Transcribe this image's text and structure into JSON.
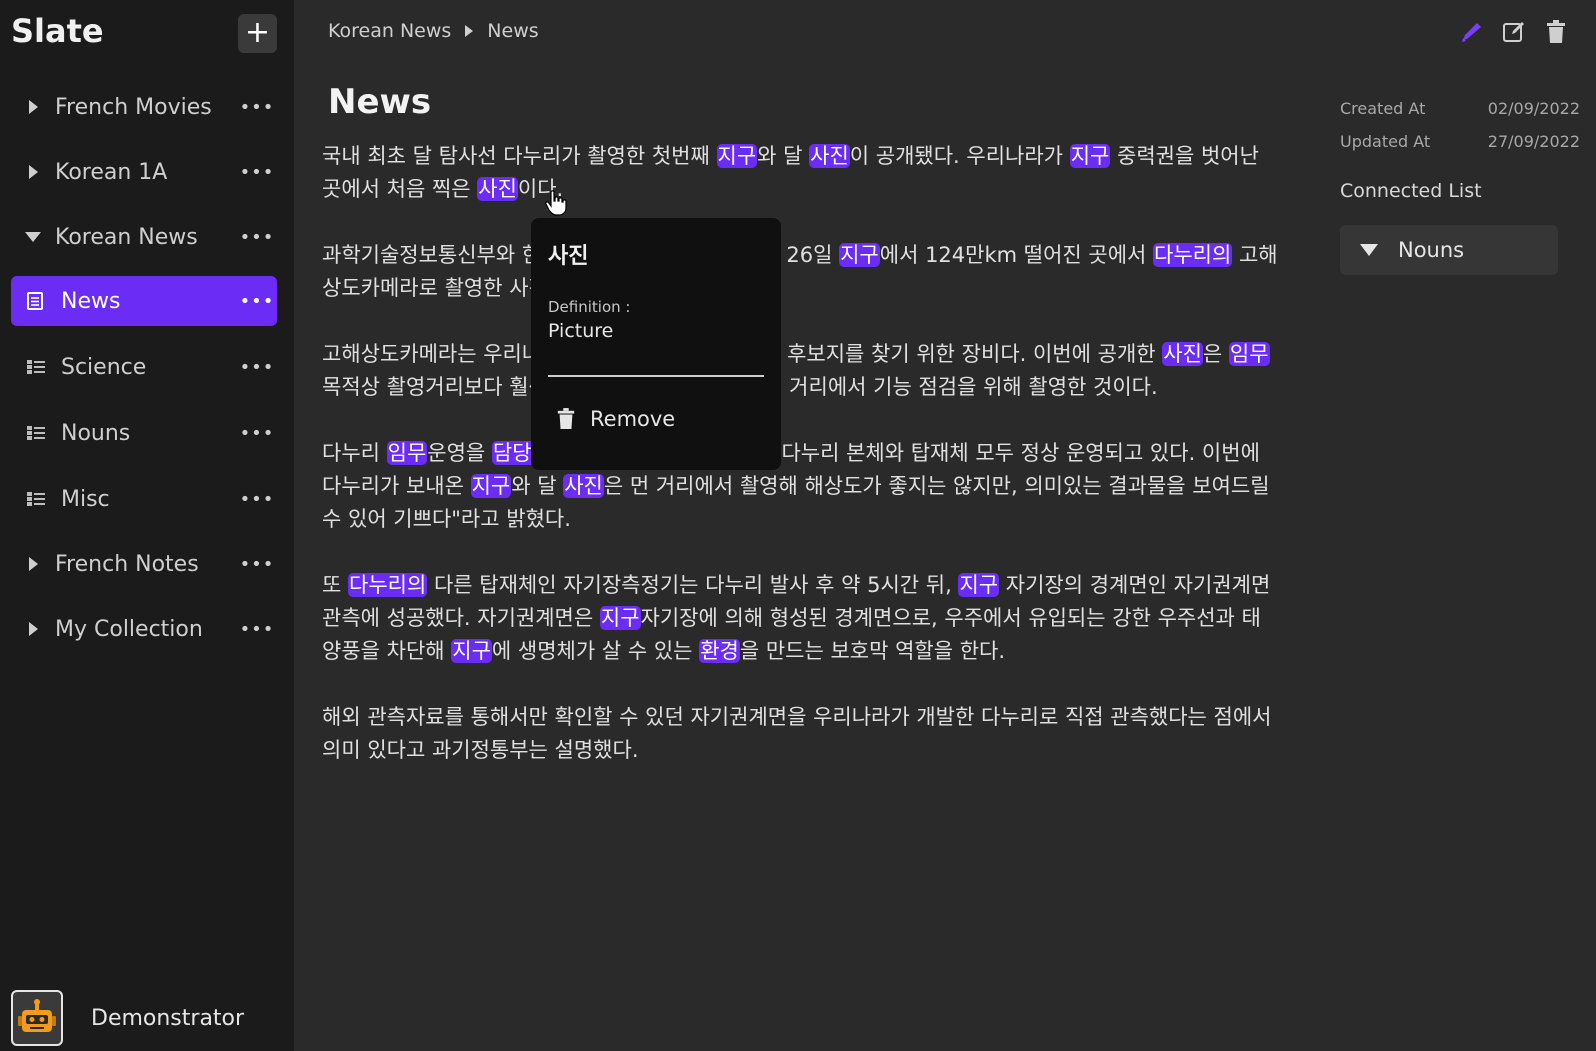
{
  "app": {
    "name": "Slate",
    "add_label": "+"
  },
  "sidebar": {
    "items": [
      {
        "label": "French Movies",
        "expanded": false
      },
      {
        "label": "Korean 1A",
        "expanded": false
      },
      {
        "label": "Korean News",
        "expanded": true
      },
      {
        "label": "News",
        "icon": "note-icon",
        "active": true
      },
      {
        "label": "Science",
        "icon": "list-icon"
      },
      {
        "label": "Nouns",
        "icon": "list-icon"
      },
      {
        "label": "Misc",
        "icon": "list-icon"
      },
      {
        "label": "French Notes",
        "expanded": false
      },
      {
        "label": "My Collection",
        "expanded": false
      }
    ],
    "more_label": "•••"
  },
  "user": {
    "name": "Demonstrator"
  },
  "breadcrumb": {
    "parent": "Korean News",
    "current": "News"
  },
  "document": {
    "title": "News",
    "paragraphs": [
      [
        {
          "t": " 국내 최초 달 탐사선 다누리가 촬영한 첫번째 "
        },
        {
          "t": "지구",
          "h": true
        },
        {
          "t": "와 달 "
        },
        {
          "t": "사진",
          "h": true
        },
        {
          "t": "이 공개됐다. 우리나라가 "
        },
        {
          "t": "지구",
          "h": true
        },
        {
          "t": " 중력권을 벗어난 곳에서 처음 찍은 "
        },
        {
          "t": "사진",
          "h": true
        },
        {
          "t": "이다."
        }
      ],
      [
        {
          "t": "과학기술정보통신부와 한국항공우주연구원은 지난달 26일 "
        },
        {
          "t": "지구",
          "h": true
        },
        {
          "t": "에서 124만km 떨어진 곳에서 "
        },
        {
          "t": "다누리의",
          "h": true
        },
        {
          "t": " 고해상도카메라로 촬영한 사진을 30일 "
        },
        {
          "t": "공개했다",
          "h": true
        },
        {
          "t": "."
        }
      ],
      [
        {
          "t": "고해상도카메라는 우리나라 최초의 달 탐사선이 착륙 후보지를 찾기 위한 장비다. 이번에 공개한 "
        },
        {
          "t": "사진",
          "h": true
        },
        {
          "t": "은 "
        },
        {
          "t": "임무",
          "h": true
        },
        {
          "t": " 목적상 촬영거리보다 훨씬 먼 100만km 이상 떨어진 거리에서 기능 점검을 위해 촬영한 것이다."
        }
      ],
      [
        {
          "t": "다누리 "
        },
        {
          "t": "임무",
          "h": true
        },
        {
          "t": "운영을 "
        },
        {
          "t": "담당하는",
          "h": true
        },
        {
          "t": " 항우연 조영호 박사는 \"다누리 본체와 탑재체 모두 정상 운영되고 있다. 이번에 다누리가 보내온 "
        },
        {
          "t": "지구",
          "h": true
        },
        {
          "t": "와 달 "
        },
        {
          "t": "사진",
          "h": true
        },
        {
          "t": "은 먼 거리에서 촬영해 해상도가 좋지는 않지만, 의미있는 결과물을 보여드릴 수 있어 기쁘다\"라고 밝혔다."
        }
      ],
      [
        {
          "t": "또 "
        },
        {
          "t": "다누리의",
          "h": true
        },
        {
          "t": " 다른 탑재체인 자기장측정기는 다누리 발사 후 약 5시간 뒤, "
        },
        {
          "t": "지구",
          "h": true
        },
        {
          "t": " 자기장의 경계면인 자기권계면 관측에 성공했다. 자기권계면은 "
        },
        {
          "t": "지구",
          "h": true
        },
        {
          "t": "자기장에 의해 형성된 경계면으로, 우주에서 유입되는 강한 우주선과 태양풍을 차단해 "
        },
        {
          "t": "지구",
          "h": true
        },
        {
          "t": "에 생명체가 살 수 있는 "
        },
        {
          "t": "환경",
          "h": true
        },
        {
          "t": "을 만드는 보호막 역할을 한다."
        }
      ],
      [
        {
          "t": "해외 관측자료를 통해서만 확인할 수 있던 자기권계면을 우리나라가 개발한 다누리로 직접 관측했다는 점에서 의미 있다고 과기정통부는 설명했다."
        }
      ]
    ]
  },
  "meta": {
    "created_label": "Created At",
    "created_value": "02/09/2022",
    "updated_label": "Updated At",
    "updated_value": "27/09/2022"
  },
  "connected": {
    "title": "Connected List",
    "item": "Nouns"
  },
  "popup": {
    "word": "사진",
    "definition_label": "Definition :",
    "definition": "Picture",
    "remove_label": "Remove"
  },
  "colors": {
    "accent": "#6b2cf5",
    "sidebar_bg": "#1b1b1b",
    "main_bg": "#2a2a2a",
    "popup_bg": "#101010"
  }
}
